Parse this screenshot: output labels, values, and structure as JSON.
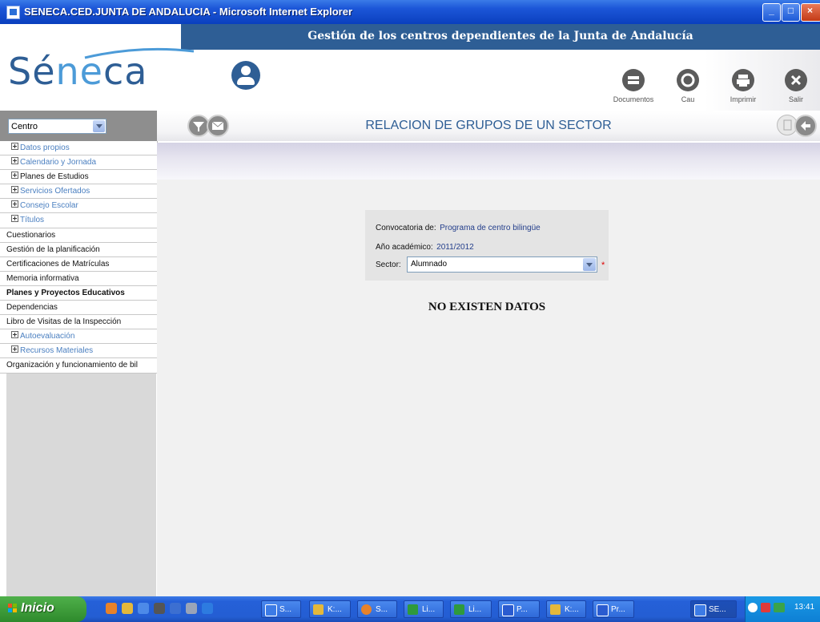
{
  "window": {
    "title": "SENECA.CED.JUNTA DE ANDALUCIA - Microsoft Internet Explorer"
  },
  "header": {
    "title": "Gestión de los centros dependientes de la Junta de Andalucía",
    "logo": "Séneca",
    "actions": [
      {
        "label": "Documentos",
        "icon": "documents-icon"
      },
      {
        "label": "Cau",
        "icon": "help-icon"
      },
      {
        "label": "Imprimir",
        "icon": "printer-icon"
      },
      {
        "label": "Salir",
        "icon": "close-icon"
      }
    ]
  },
  "sidebar": {
    "selector_value": "Centro",
    "items": [
      {
        "label": "Datos propios",
        "expandable": true
      },
      {
        "label": "Calendario y Jornada",
        "expandable": true
      },
      {
        "label": "Planes de Estudios",
        "expandable": true
      },
      {
        "label": "Servicios Ofertados",
        "expandable": true
      },
      {
        "label": "Consejo Escolar",
        "expandable": true
      },
      {
        "label": "Títulos",
        "expandable": true
      },
      {
        "label": "Cuestionarios",
        "expandable": false
      },
      {
        "label": "Gestión de la planificación",
        "expandable": false
      },
      {
        "label": "Certificaciones de Matrículas",
        "expandable": false
      },
      {
        "label": "Memoria informativa",
        "expandable": false
      },
      {
        "label": "Planes y Proyectos Educativos",
        "expandable": false
      },
      {
        "label": "Dependencias",
        "expandable": false
      },
      {
        "label": "Libro de Visitas de la Inspección",
        "expandable": false
      },
      {
        "label": "Autoevaluación",
        "expandable": true
      },
      {
        "label": "Recursos Materiales",
        "expandable": true
      },
      {
        "label": "Organización y funcionamiento de bil",
        "expandable": false
      }
    ]
  },
  "main": {
    "page_title": "RELACION DE GRUPOS DE UN SECTOR",
    "filters": {
      "convocatoria_label": "Convocatoria de:",
      "convocatoria_value": "Programa de centro bilingüe",
      "anio_label": "Año académico:",
      "anio_value": "2011/2012",
      "sector_label": "Sector:",
      "sector_value": "Alumnado",
      "required_mark": "*"
    },
    "empty_message": "NO EXISTEN DATOS"
  },
  "taskbar": {
    "start_label": "Inicio",
    "tasks": [
      "S...",
      "K:...",
      "S...",
      "Li...",
      "Li...",
      "P...",
      "K:...",
      "Pr...",
      "SE..."
    ],
    "clock": "13:41"
  },
  "colors": {
    "brand": "#2e5e95",
    "link": "#233e8b",
    "sidebar_expandable": "#4a7fc0"
  }
}
